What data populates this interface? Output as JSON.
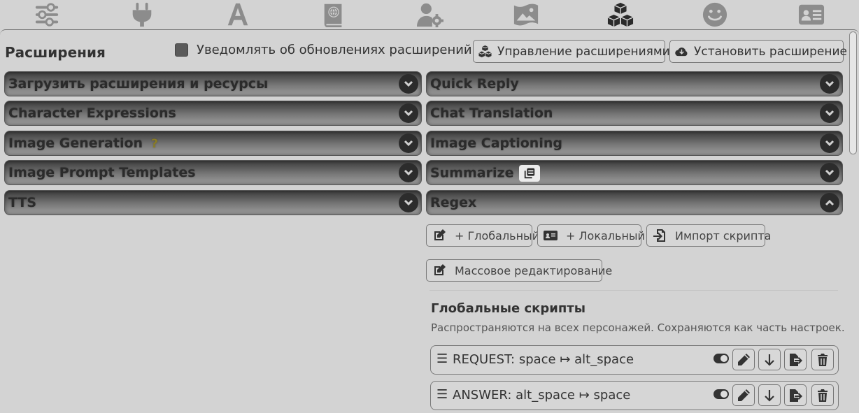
{
  "top_nav": {
    "icons": [
      "sliders-icon",
      "plug-icon",
      "font-icon",
      "book-globe-icon",
      "user-gear-icon",
      "image-icon",
      "cubes-icon",
      "smiley-icon",
      "id-card-icon"
    ],
    "active": "cubes-icon"
  },
  "header": {
    "title": "Расширения",
    "notify_label": "Уведомлять об обновлениях расширений",
    "notify_checked": false,
    "manage_label": "Управление расширениями",
    "install_label": "Установить расширение"
  },
  "left_drawers": [
    {
      "label": "Загрузить расширения и ресурсы"
    },
    {
      "label": "Character Expressions"
    },
    {
      "label": "Image Generation",
      "extra": "?"
    },
    {
      "label": "Image Prompt Templates"
    },
    {
      "label": "TTS"
    }
  ],
  "right_drawers": [
    {
      "label": "Quick Reply"
    },
    {
      "label": "Chat Translation"
    },
    {
      "label": "Image Captioning"
    },
    {
      "label": "Summarize"
    },
    {
      "label": "Regex",
      "expanded": true
    }
  ],
  "regex": {
    "add_global_label": "+ Глобальный",
    "add_local_label": "+ Локальный",
    "import_label": "Импорт скрипта",
    "bulk_edit_label": "Массовое редактирование",
    "global_title": "Глобальные скрипты",
    "global_desc": "Распространяются на всех персонажей. Сохраняются как часть настроек.",
    "scripts": [
      {
        "handle": "☰",
        "name": "REQUEST: space ↦ alt_space",
        "enabled": true
      },
      {
        "handle": "☰",
        "name": "ANSWER: alt_space ↦ space",
        "enabled": true
      }
    ]
  },
  "colors": {
    "background": "#d3d3d3",
    "drawer_dark": "#3c3c3c",
    "chevron_bg": "#2c2c2c",
    "active_icon": "#2b2b2b",
    "inactive_icon": "#8c8c8c"
  }
}
